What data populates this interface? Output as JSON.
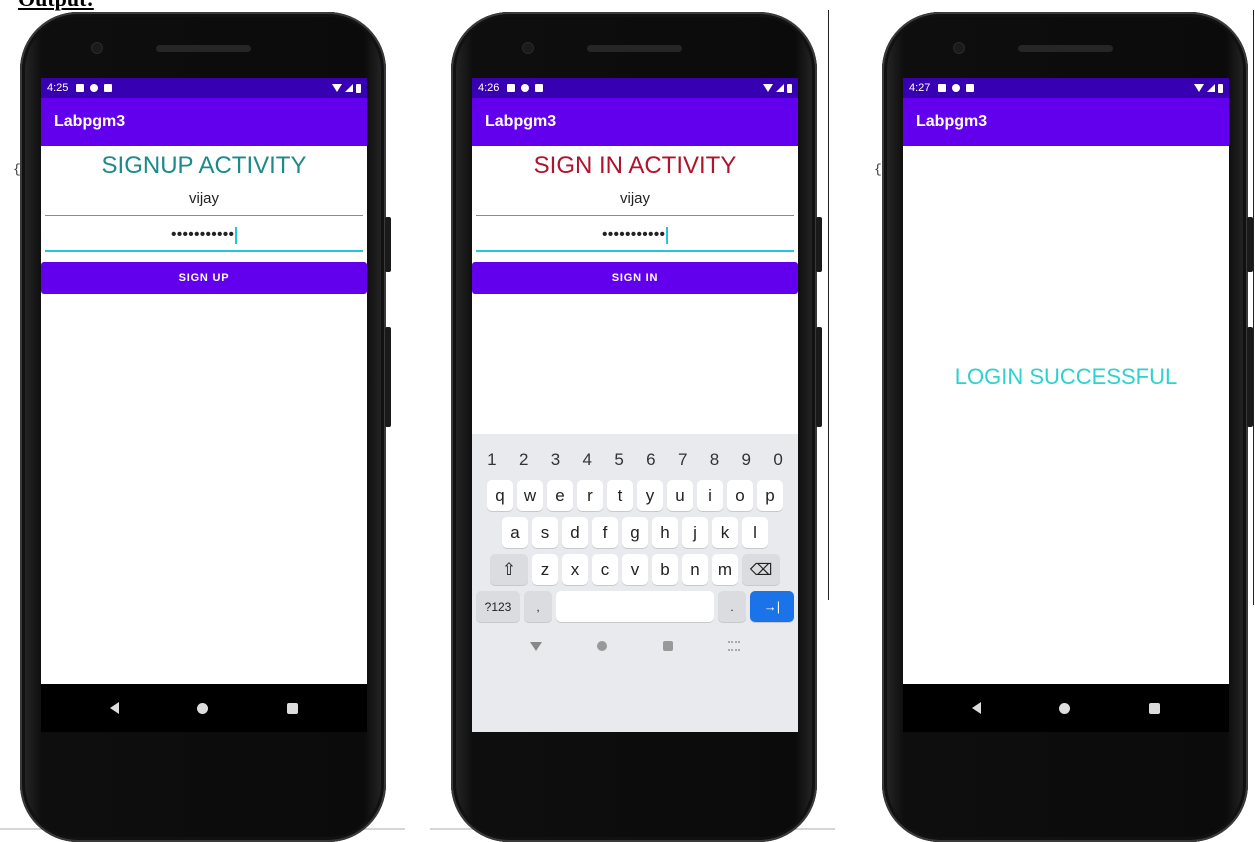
{
  "document": {
    "heading": "Output:",
    "brace": "{"
  },
  "colors": {
    "status_bar": "#3700b3",
    "app_bar": "#6200ee",
    "signup_title": "#1c8a8a",
    "signin_title": "#b0132b",
    "success_text": "#2bd2cf",
    "focus_line": "#26c6da"
  },
  "phones": [
    {
      "status_time": "4:25",
      "app_title": "Labpgm3",
      "activity_title": "SIGNUP ACTIVITY",
      "username_value": "vijay",
      "password_value": "•••••••••••",
      "button_label": "SIGN UP"
    },
    {
      "status_time": "4:26",
      "app_title": "Labpgm3",
      "activity_title": "SIGN IN ACTIVITY",
      "username_value": "vijay",
      "password_value": "•••••••••••",
      "button_label": "SIGN IN",
      "keyboard": {
        "numbers": [
          "1",
          "2",
          "3",
          "4",
          "5",
          "6",
          "7",
          "8",
          "9",
          "0"
        ],
        "row1": [
          "q",
          "w",
          "e",
          "r",
          "t",
          "y",
          "u",
          "i",
          "o",
          "p"
        ],
        "row2": [
          "a",
          "s",
          "d",
          "f",
          "g",
          "h",
          "j",
          "k",
          "l"
        ],
        "row3": [
          "z",
          "x",
          "c",
          "v",
          "b",
          "n",
          "m"
        ],
        "symbols_key": "?123",
        "comma_key": ",",
        "period_key": ".",
        "enter_symbol": "→|",
        "shift_symbol": "⇧",
        "backspace_symbol": "⌫"
      }
    },
    {
      "status_time": "4:27",
      "app_title": "Labpgm3",
      "message": "LOGIN SUCCESSFUL"
    }
  ]
}
